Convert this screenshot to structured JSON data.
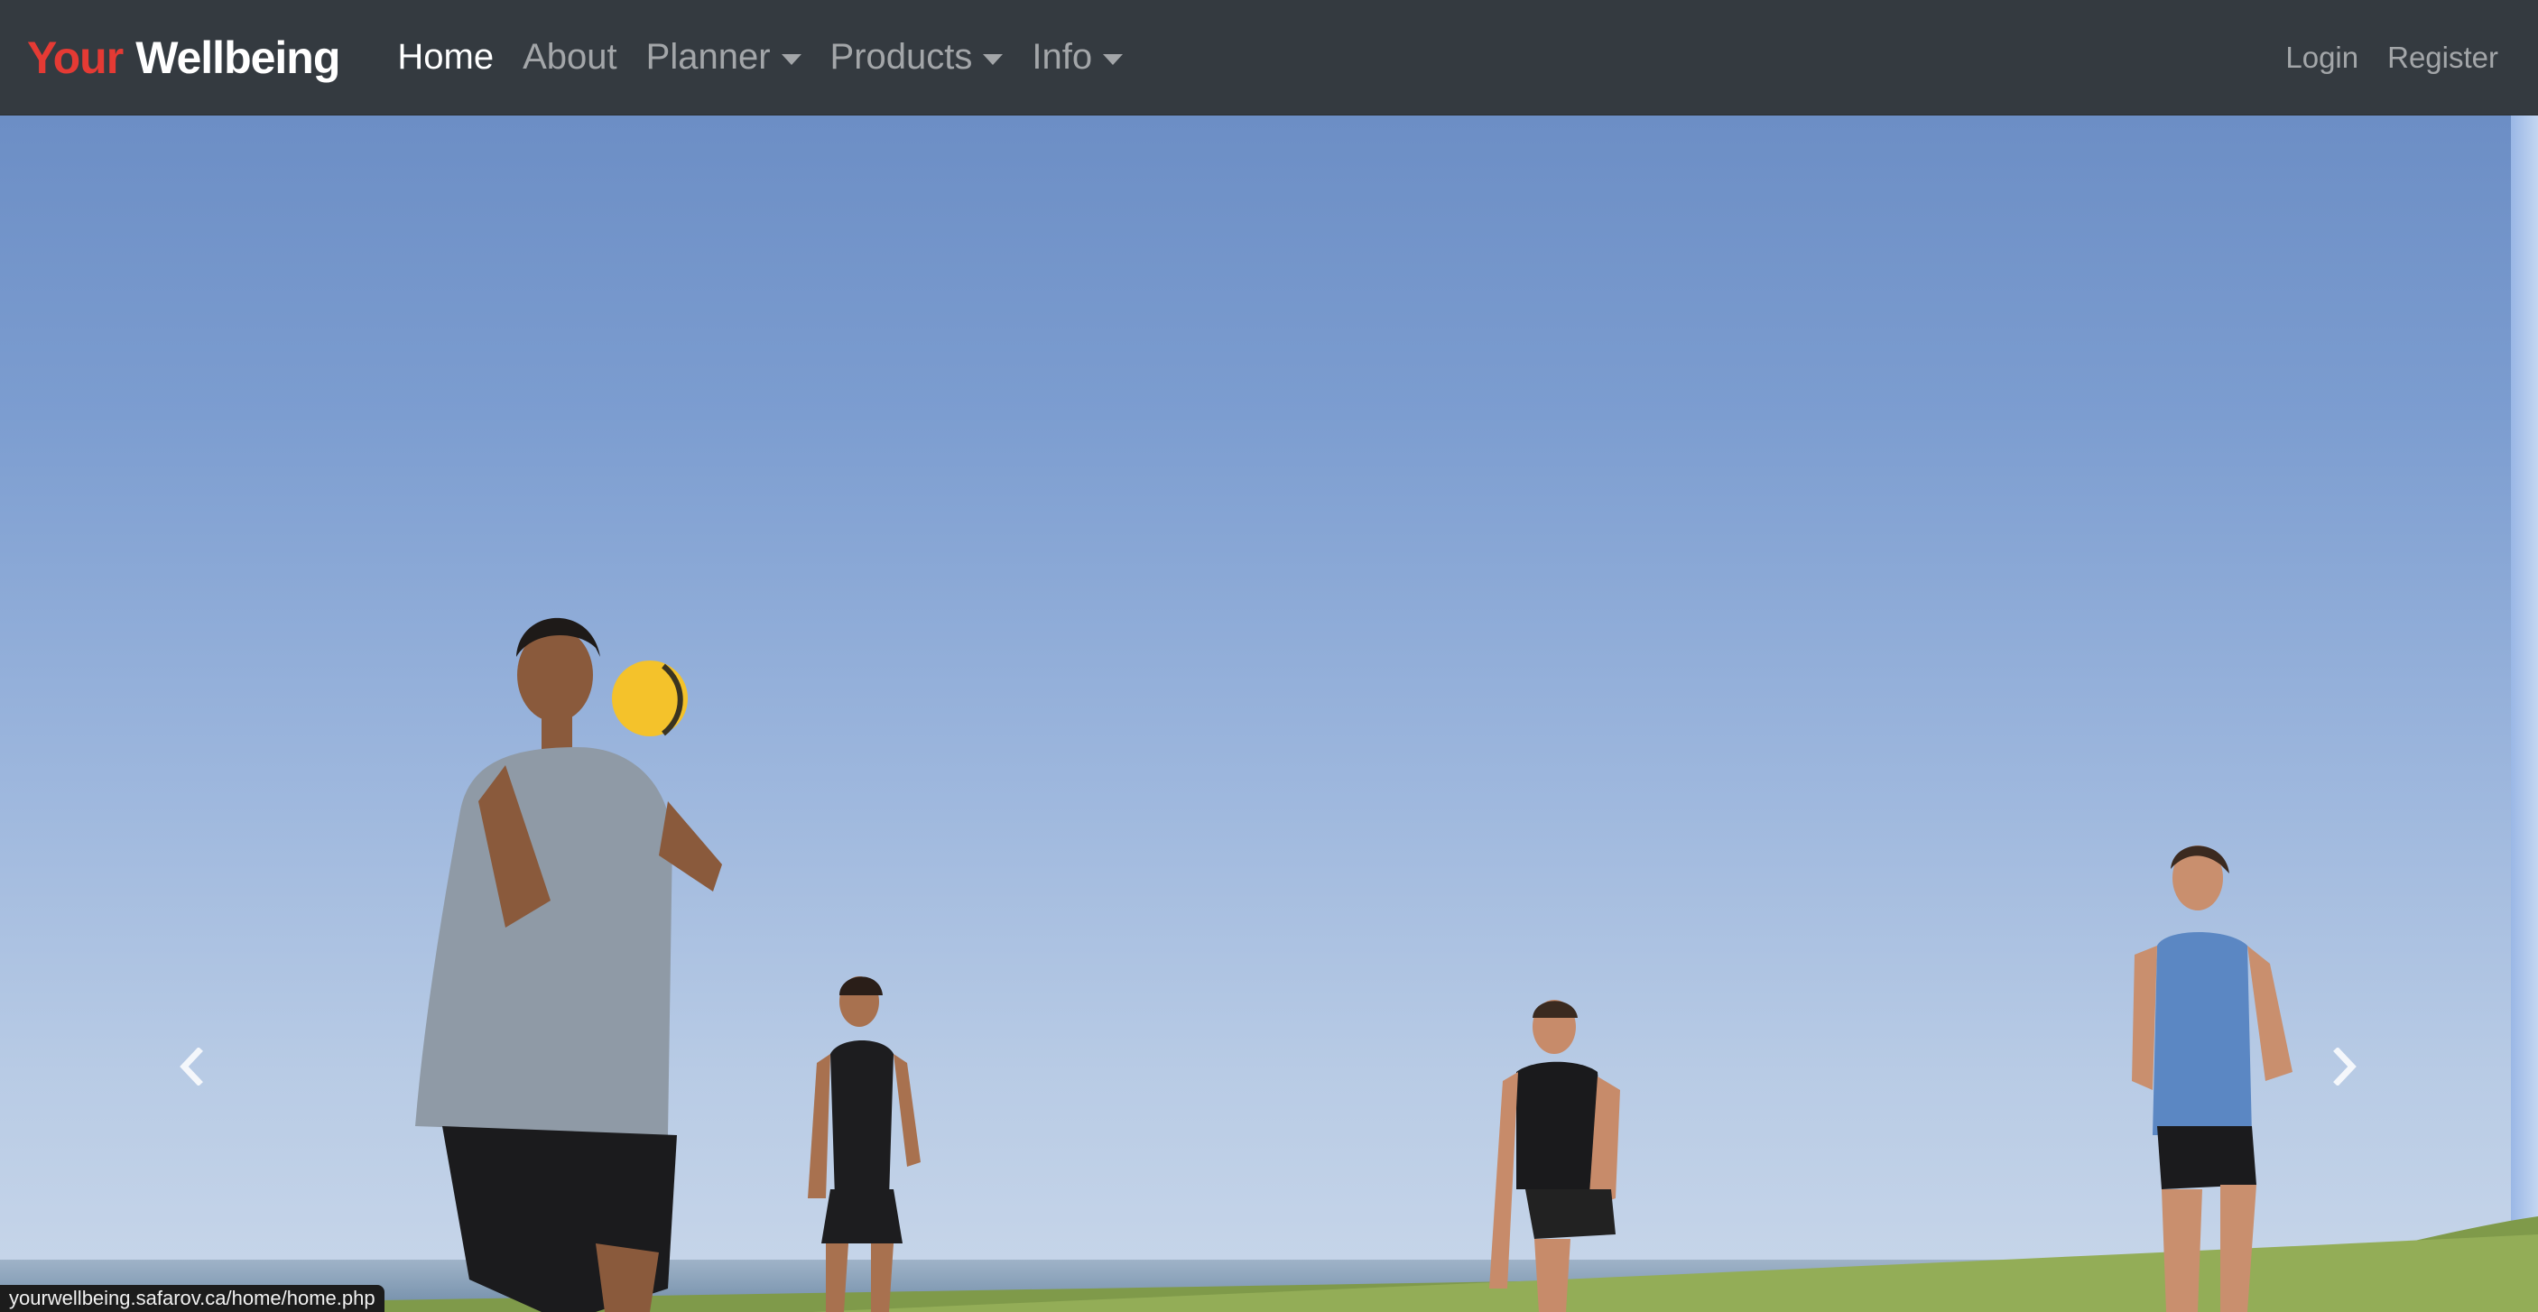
{
  "brand": {
    "part1": "Your",
    "part2": "Wellbeing"
  },
  "nav": {
    "home": "Home",
    "about": "About",
    "planner": "Planner",
    "products": "Products",
    "info": "Info",
    "login": "Login",
    "register": "Register"
  },
  "carousel": {
    "prev_icon": "chevron-left-icon",
    "next_icon": "chevron-right-icon"
  },
  "status_bar": {
    "url": "yourwellbeing.safarov.ca/home/home.php"
  },
  "colors": {
    "navbar_bg": "#343a40",
    "brand_accent": "#e53a34",
    "nav_active": "#ffffff",
    "nav_inactive": "rgba(255,255,255,0.55)"
  }
}
